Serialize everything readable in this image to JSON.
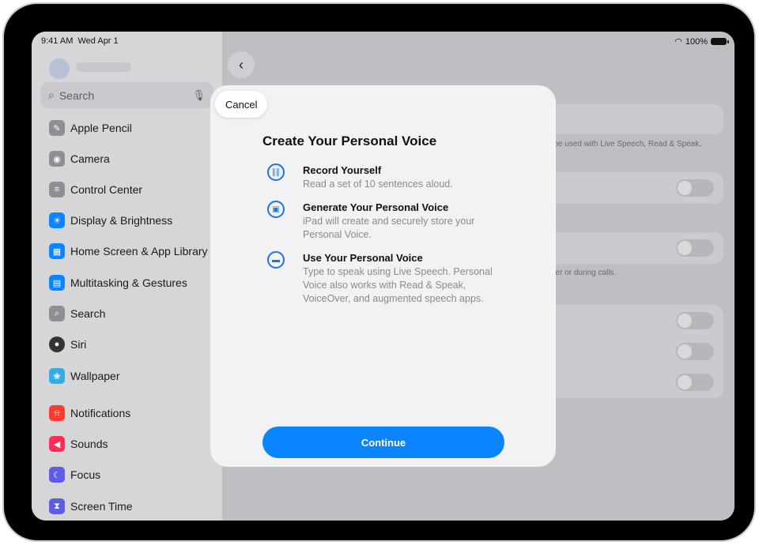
{
  "status": {
    "time": "9:41 AM",
    "date": "Wed Apr 1",
    "battery": "100%"
  },
  "search": {
    "placeholder": "Search"
  },
  "sidebar": {
    "items": [
      {
        "label": "Apple Pencil",
        "icon": "pencil-icon",
        "color": "#8e8e93"
      },
      {
        "label": "Camera",
        "icon": "camera-icon",
        "color": "#8e8e93"
      },
      {
        "label": "Control Center",
        "icon": "control-center-icon",
        "color": "#8e8e93"
      },
      {
        "label": "Display & Brightness",
        "icon": "sun-icon",
        "color": "#0a84ff"
      },
      {
        "label": "Home Screen & App Library",
        "icon": "home-screen-icon",
        "color": "#0a84ff"
      },
      {
        "label": "Multitasking & Gestures",
        "icon": "multitasking-icon",
        "color": "#0a84ff"
      },
      {
        "label": "Search",
        "icon": "search-icon",
        "color": "#8e8e93"
      },
      {
        "label": "Siri",
        "icon": "siri-icon",
        "color": "#333333"
      },
      {
        "label": "Wallpaper",
        "icon": "wallpaper-icon",
        "color": "#32ade6"
      },
      {
        "label": "Notifications",
        "icon": "bell-icon",
        "color": "#ff3b30"
      },
      {
        "label": "Sounds",
        "icon": "speaker-icon",
        "color": "#ff2d55"
      },
      {
        "label": "Focus",
        "icon": "moon-icon",
        "color": "#5e5ce6"
      },
      {
        "label": "Screen Time",
        "icon": "hourglass-icon",
        "color": "#5e5ce6"
      }
    ]
  },
  "background": {
    "footnote1": "n be used with Live Speech, Read & Speak,",
    "footnote2": "aker or during calls."
  },
  "modal": {
    "cancel_label": "Cancel",
    "title": "Create Your Personal Voice",
    "features": [
      {
        "title": "Record Yourself",
        "description": "Read a set of 10 sentences aloud.",
        "icon": "waveform-icon"
      },
      {
        "title": "Generate Your Personal Voice",
        "description": "iPad will create and securely store your Personal Voice.",
        "icon": "lock-icon"
      },
      {
        "title": "Use Your Personal Voice",
        "description": "Type to speak using Live Speech. Personal Voice also works with Read & Speak, VoiceOver, and augmented speech apps.",
        "icon": "speech-bubble-icon"
      }
    ],
    "continue_label": "Continue"
  }
}
